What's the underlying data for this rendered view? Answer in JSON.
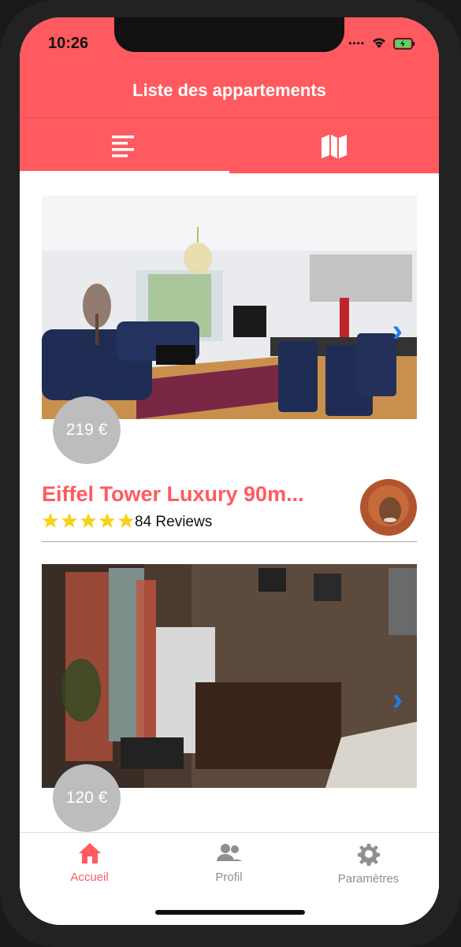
{
  "status": {
    "time": "10:26"
  },
  "header": {
    "title": "Liste des appartements"
  },
  "tabs": [
    {
      "name": "list",
      "icon": "list-icon",
      "active": true
    },
    {
      "name": "map",
      "icon": "map-icon",
      "active": false
    }
  ],
  "listings": [
    {
      "price": "219 €",
      "title": "Eiffel Tower Luxury 90m...",
      "rating": 5,
      "reviews": "84 Reviews",
      "host_avatar": "host-avatar"
    },
    {
      "price": "120 €"
    }
  ],
  "nav": [
    {
      "label": "Accueil",
      "icon": "home-icon",
      "active": true
    },
    {
      "label": "Profil",
      "icon": "users-icon",
      "active": false
    },
    {
      "label": "Paramètres",
      "icon": "gear-icon",
      "active": false
    }
  ],
  "colors": {
    "brand": "#FF5A5F",
    "chevron": "#1e7df2",
    "star": "#F7D11A",
    "inactive": "#8e8e93"
  }
}
